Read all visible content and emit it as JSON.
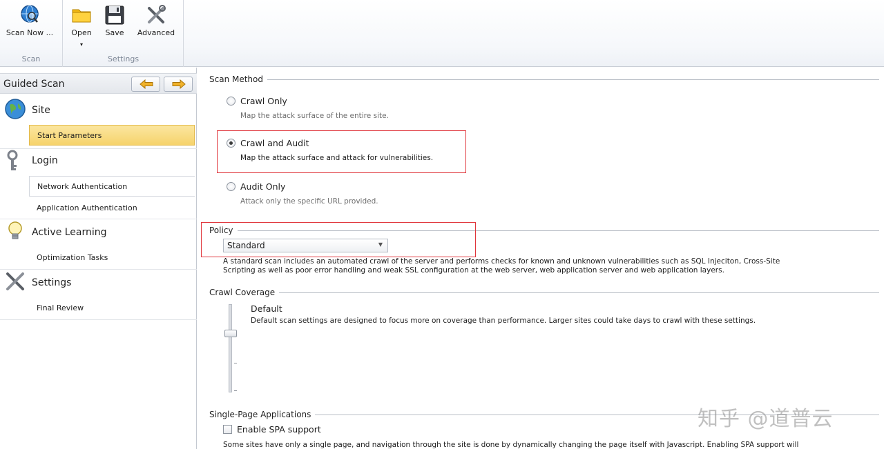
{
  "ribbon": {
    "scan_now": "Scan Now ...",
    "open": "Open",
    "open_caret": "▾",
    "save": "Save",
    "advanced": "Advanced",
    "group_scan": "Scan",
    "group_settings": "Settings"
  },
  "sidebar": {
    "title": "Guided Scan",
    "sections": [
      {
        "title": "Site",
        "icon": "globe-icon",
        "items": [
          "Start Parameters"
        ]
      },
      {
        "title": "Login",
        "icon": "keys-icon",
        "items": [
          "Network Authentication",
          "Application Authentication"
        ]
      },
      {
        "title": "Active Learning",
        "icon": "lightbulb-icon",
        "items": [
          "Optimization Tasks"
        ]
      },
      {
        "title": "Settings",
        "icon": "tools-icon",
        "items": [
          "Final Review"
        ]
      }
    ]
  },
  "scan_method": {
    "title": "Scan Method",
    "options": [
      {
        "label": "Crawl Only",
        "desc": "Map the attack surface of the entire site.",
        "checked": false
      },
      {
        "label": "Crawl and Audit",
        "desc": "Map the attack surface and attack for vulnerabilities.",
        "checked": true
      },
      {
        "label": "Audit Only",
        "desc": "Attack only the specific URL provided.",
        "checked": false
      }
    ]
  },
  "policy": {
    "title": "Policy",
    "selected": "Standard",
    "desc_line1": "A standard scan includes an automated crawl of the server and performs checks for known and unknown vulnerabilities such as SQL Injeciton, Cross-Site",
    "desc_line2": "Scripting as well as poor error handling and weak SSL configuration at the web server, web application server and web application layers."
  },
  "crawl_coverage": {
    "title": "Crawl Coverage",
    "level_name": "Default",
    "desc": "Default scan settings are designed to focus more on coverage than performance. Larger sites could take days to crawl with these settings."
  },
  "spa": {
    "title": "Single-Page Applications",
    "checkbox_label": "Enable SPA support",
    "checked": false,
    "desc": "Some sites have only a single page, and navigation through the site is done by dynamically changing the page itself with Javascript. Enabling SPA support will"
  },
  "watermark": "知乎 @道普云",
  "colors": {
    "highlight_box": "#e0353b",
    "active_nav": "#f6d36c"
  }
}
